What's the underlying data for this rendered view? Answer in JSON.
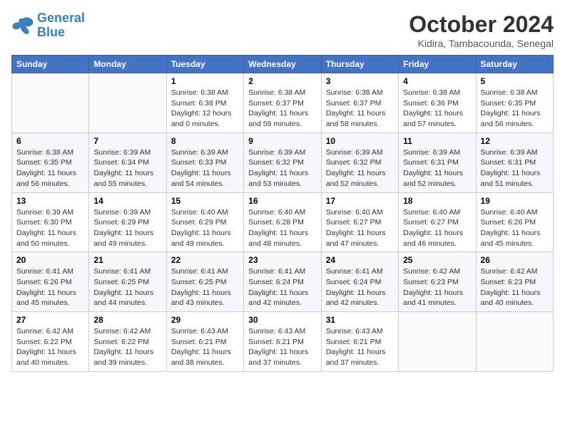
{
  "logo": {
    "line1": "General",
    "line2": "Blue"
  },
  "title": "October 2024",
  "location": "Kidira, Tambacounda, Senegal",
  "days_of_week": [
    "Sunday",
    "Monday",
    "Tuesday",
    "Wednesday",
    "Thursday",
    "Friday",
    "Saturday"
  ],
  "weeks": [
    [
      {
        "day": "",
        "info": ""
      },
      {
        "day": "",
        "info": ""
      },
      {
        "day": "1",
        "info": "Sunrise: 6:38 AM\nSunset: 6:38 PM\nDaylight: 12 hours and 0 minutes."
      },
      {
        "day": "2",
        "info": "Sunrise: 6:38 AM\nSunset: 6:37 PM\nDaylight: 11 hours and 59 minutes."
      },
      {
        "day": "3",
        "info": "Sunrise: 6:38 AM\nSunset: 6:37 PM\nDaylight: 11 hours and 58 minutes."
      },
      {
        "day": "4",
        "info": "Sunrise: 6:38 AM\nSunset: 6:36 PM\nDaylight: 11 hours and 57 minutes."
      },
      {
        "day": "5",
        "info": "Sunrise: 6:38 AM\nSunset: 6:35 PM\nDaylight: 11 hours and 56 minutes."
      }
    ],
    [
      {
        "day": "6",
        "info": "Sunrise: 6:38 AM\nSunset: 6:35 PM\nDaylight: 11 hours and 56 minutes."
      },
      {
        "day": "7",
        "info": "Sunrise: 6:39 AM\nSunset: 6:34 PM\nDaylight: 11 hours and 55 minutes."
      },
      {
        "day": "8",
        "info": "Sunrise: 6:39 AM\nSunset: 6:33 PM\nDaylight: 11 hours and 54 minutes."
      },
      {
        "day": "9",
        "info": "Sunrise: 6:39 AM\nSunset: 6:32 PM\nDaylight: 11 hours and 53 minutes."
      },
      {
        "day": "10",
        "info": "Sunrise: 6:39 AM\nSunset: 6:32 PM\nDaylight: 11 hours and 52 minutes."
      },
      {
        "day": "11",
        "info": "Sunrise: 6:39 AM\nSunset: 6:31 PM\nDaylight: 11 hours and 52 minutes."
      },
      {
        "day": "12",
        "info": "Sunrise: 6:39 AM\nSunset: 6:31 PM\nDaylight: 11 hours and 51 minutes."
      }
    ],
    [
      {
        "day": "13",
        "info": "Sunrise: 6:39 AM\nSunset: 6:30 PM\nDaylight: 11 hours and 50 minutes."
      },
      {
        "day": "14",
        "info": "Sunrise: 6:39 AM\nSunset: 6:29 PM\nDaylight: 11 hours and 49 minutes."
      },
      {
        "day": "15",
        "info": "Sunrise: 6:40 AM\nSunset: 6:29 PM\nDaylight: 11 hours and 49 minutes."
      },
      {
        "day": "16",
        "info": "Sunrise: 6:40 AM\nSunset: 6:28 PM\nDaylight: 11 hours and 48 minutes."
      },
      {
        "day": "17",
        "info": "Sunrise: 6:40 AM\nSunset: 6:27 PM\nDaylight: 11 hours and 47 minutes."
      },
      {
        "day": "18",
        "info": "Sunrise: 6:40 AM\nSunset: 6:27 PM\nDaylight: 11 hours and 46 minutes."
      },
      {
        "day": "19",
        "info": "Sunrise: 6:40 AM\nSunset: 6:26 PM\nDaylight: 11 hours and 45 minutes."
      }
    ],
    [
      {
        "day": "20",
        "info": "Sunrise: 6:41 AM\nSunset: 6:26 PM\nDaylight: 11 hours and 45 minutes."
      },
      {
        "day": "21",
        "info": "Sunrise: 6:41 AM\nSunset: 6:25 PM\nDaylight: 11 hours and 44 minutes."
      },
      {
        "day": "22",
        "info": "Sunrise: 6:41 AM\nSunset: 6:25 PM\nDaylight: 11 hours and 43 minutes."
      },
      {
        "day": "23",
        "info": "Sunrise: 6:41 AM\nSunset: 6:24 PM\nDaylight: 11 hours and 42 minutes."
      },
      {
        "day": "24",
        "info": "Sunrise: 6:41 AM\nSunset: 6:24 PM\nDaylight: 11 hours and 42 minutes."
      },
      {
        "day": "25",
        "info": "Sunrise: 6:42 AM\nSunset: 6:23 PM\nDaylight: 11 hours and 41 minutes."
      },
      {
        "day": "26",
        "info": "Sunrise: 6:42 AM\nSunset: 6:23 PM\nDaylight: 11 hours and 40 minutes."
      }
    ],
    [
      {
        "day": "27",
        "info": "Sunrise: 6:42 AM\nSunset: 6:22 PM\nDaylight: 11 hours and 40 minutes."
      },
      {
        "day": "28",
        "info": "Sunrise: 6:42 AM\nSunset: 6:22 PM\nDaylight: 11 hours and 39 minutes."
      },
      {
        "day": "29",
        "info": "Sunrise: 6:43 AM\nSunset: 6:21 PM\nDaylight: 11 hours and 38 minutes."
      },
      {
        "day": "30",
        "info": "Sunrise: 6:43 AM\nSunset: 6:21 PM\nDaylight: 11 hours and 37 minutes."
      },
      {
        "day": "31",
        "info": "Sunrise: 6:43 AM\nSunset: 6:21 PM\nDaylight: 11 hours and 37 minutes."
      },
      {
        "day": "",
        "info": ""
      },
      {
        "day": "",
        "info": ""
      }
    ]
  ]
}
